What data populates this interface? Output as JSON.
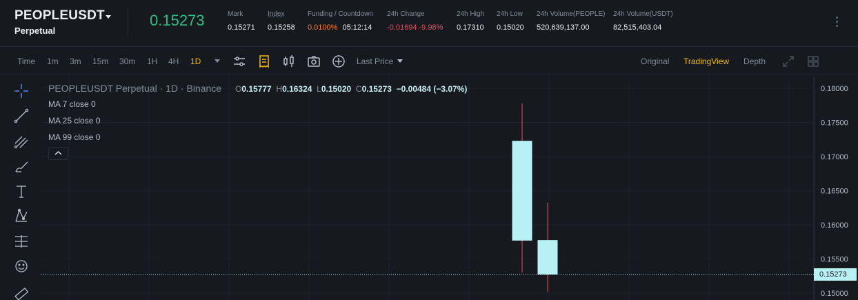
{
  "header": {
    "symbol": "PEOPLEUSDT",
    "contract": "Perpetual",
    "last_price": "0.15273",
    "stats": {
      "mark_label": "Mark",
      "mark_value": "0.15271",
      "index_label": "Index",
      "index_value": "0.15258",
      "funding_label": "Funding / Countdown",
      "funding_rate": "0.0100%",
      "countdown": "05:12:14",
      "change_label": "24h Change",
      "change_value": "-0.01694 -9.98%",
      "high_label": "24h High",
      "high_value": "0.17310",
      "low_label": "24h Low",
      "low_value": "0.15020",
      "vol_base_label": "24h Volume(PEOPLE)",
      "vol_base_value": "520,639,137.00",
      "vol_quote_label": "24h Volume(USDT)",
      "vol_quote_value": "82,515,403.04"
    }
  },
  "toolbar": {
    "time_label": "Time",
    "intervals": [
      "1m",
      "3m",
      "15m",
      "30m",
      "1H",
      "4H",
      "1D"
    ],
    "active_interval": "1D",
    "price_type": "Last Price",
    "views": [
      "Original",
      "TradingView",
      "Depth"
    ],
    "active_view": "TradingView"
  },
  "legend": {
    "title": "PEOPLEUSDT Perpetual · 1D · Binance",
    "o_label": "O",
    "o_value": "0.15777",
    "h_label": "H",
    "h_value": "0.16324",
    "l_label": "L",
    "l_value": "0.15020",
    "c_label": "C",
    "c_value": "0.15273",
    "change": "−0.00484 (−3.07%)",
    "ma": [
      "MA 7 close 0",
      "MA 25 close 0",
      "MA 99 close 0"
    ]
  },
  "colors": {
    "background": "#161a1e",
    "up": "#2ebd85",
    "down": "#f6465d",
    "accent": "#f0b90b",
    "candle": "#b7f0f5",
    "wick": "#f6465d",
    "grid": "#1f2329",
    "axis_text": "#b7bdc6"
  },
  "chart_data": {
    "type": "candlestick",
    "y_ticks": [
      "0.18000",
      "0.17500",
      "0.17000",
      "0.16500",
      "0.16000",
      "0.15500",
      "0.15000"
    ],
    "ylim": [
      0.149,
      0.181
    ],
    "last_price_label": "0.15273",
    "last_price": 0.15273,
    "candles": [
      {
        "open": 0.1723,
        "high": 0.1778,
        "low": 0.153,
        "close": 0.1577
      },
      {
        "open": 0.15777,
        "high": 0.16324,
        "low": 0.1502,
        "close": 0.15273
      }
    ]
  },
  "icons": {
    "toolbar": [
      "indicator-settings-icon",
      "receipt-icon",
      "candle-type-icon",
      "camera-icon",
      "add-circle-icon",
      "expand-icon",
      "grid-layout-icon"
    ],
    "tools": [
      "crosshair-icon",
      "trend-line-icon",
      "fib-icon",
      "brush-icon",
      "text-icon",
      "pattern-icon",
      "measure-icon",
      "emoji-icon",
      "ruler-icon"
    ]
  }
}
